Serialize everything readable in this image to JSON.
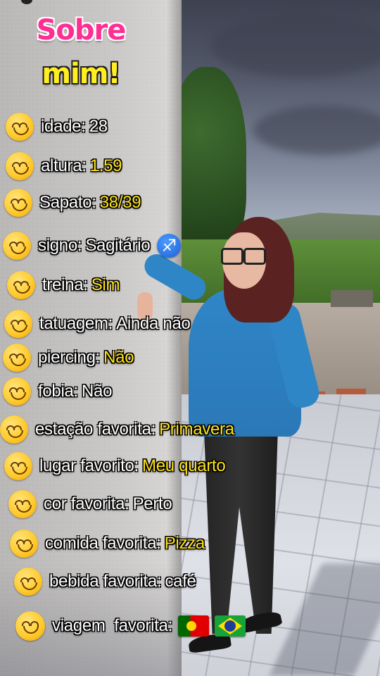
{
  "title": {
    "line1": "Sobre",
    "line2": "mim!"
  },
  "colors": {
    "title_pink": "#ff2e93",
    "title_yellow": "#ffee22",
    "highlight_yellow": "#ffe21a",
    "text_white": "#ffffff"
  },
  "items": [
    {
      "label": "idade:",
      "value": "28",
      "icon": "smiling-face-icon"
    },
    {
      "label": "altura:",
      "value": "1.59",
      "icon": "smiling-face-icon"
    },
    {
      "label": "Sapato:",
      "value": "38/39",
      "icon": "smiling-face-icon"
    },
    {
      "label": "signo:",
      "value": "Sagitário",
      "icon": "smiling-face-icon",
      "extra_icon": "sagittarius-icon",
      "extra_glyph": "♐"
    },
    {
      "label": "treina:",
      "value": "Sim",
      "icon": "smiling-face-icon"
    },
    {
      "label": "tatuagem:",
      "value": "Ainda não",
      "icon": "smiling-face-icon"
    },
    {
      "label": "piercing:",
      "value": "Não",
      "icon": "smiling-face-icon"
    },
    {
      "label": "fobia:",
      "value": "Não",
      "icon": "smiling-face-icon"
    },
    {
      "label": "estação favorita:",
      "value": "Primavera",
      "icon": "smiling-face-icon"
    },
    {
      "label": "lugar favorito:",
      "value": "Meu quarto",
      "icon": "smiling-face-icon"
    },
    {
      "label": "cor favorita:",
      "value": "Perto",
      "icon": "smiling-face-icon"
    },
    {
      "label": "comida favorita:",
      "value": "Pizza",
      "icon": "smiling-face-icon"
    },
    {
      "label": "bebida favorita:",
      "value": "café",
      "icon": "smiling-face-icon"
    },
    {
      "label": "viagem  favorita:",
      "value": "",
      "icon": "smiling-face-icon",
      "flags": [
        "portugal-flag-icon",
        "brazil-flag-icon"
      ]
    }
  ]
}
